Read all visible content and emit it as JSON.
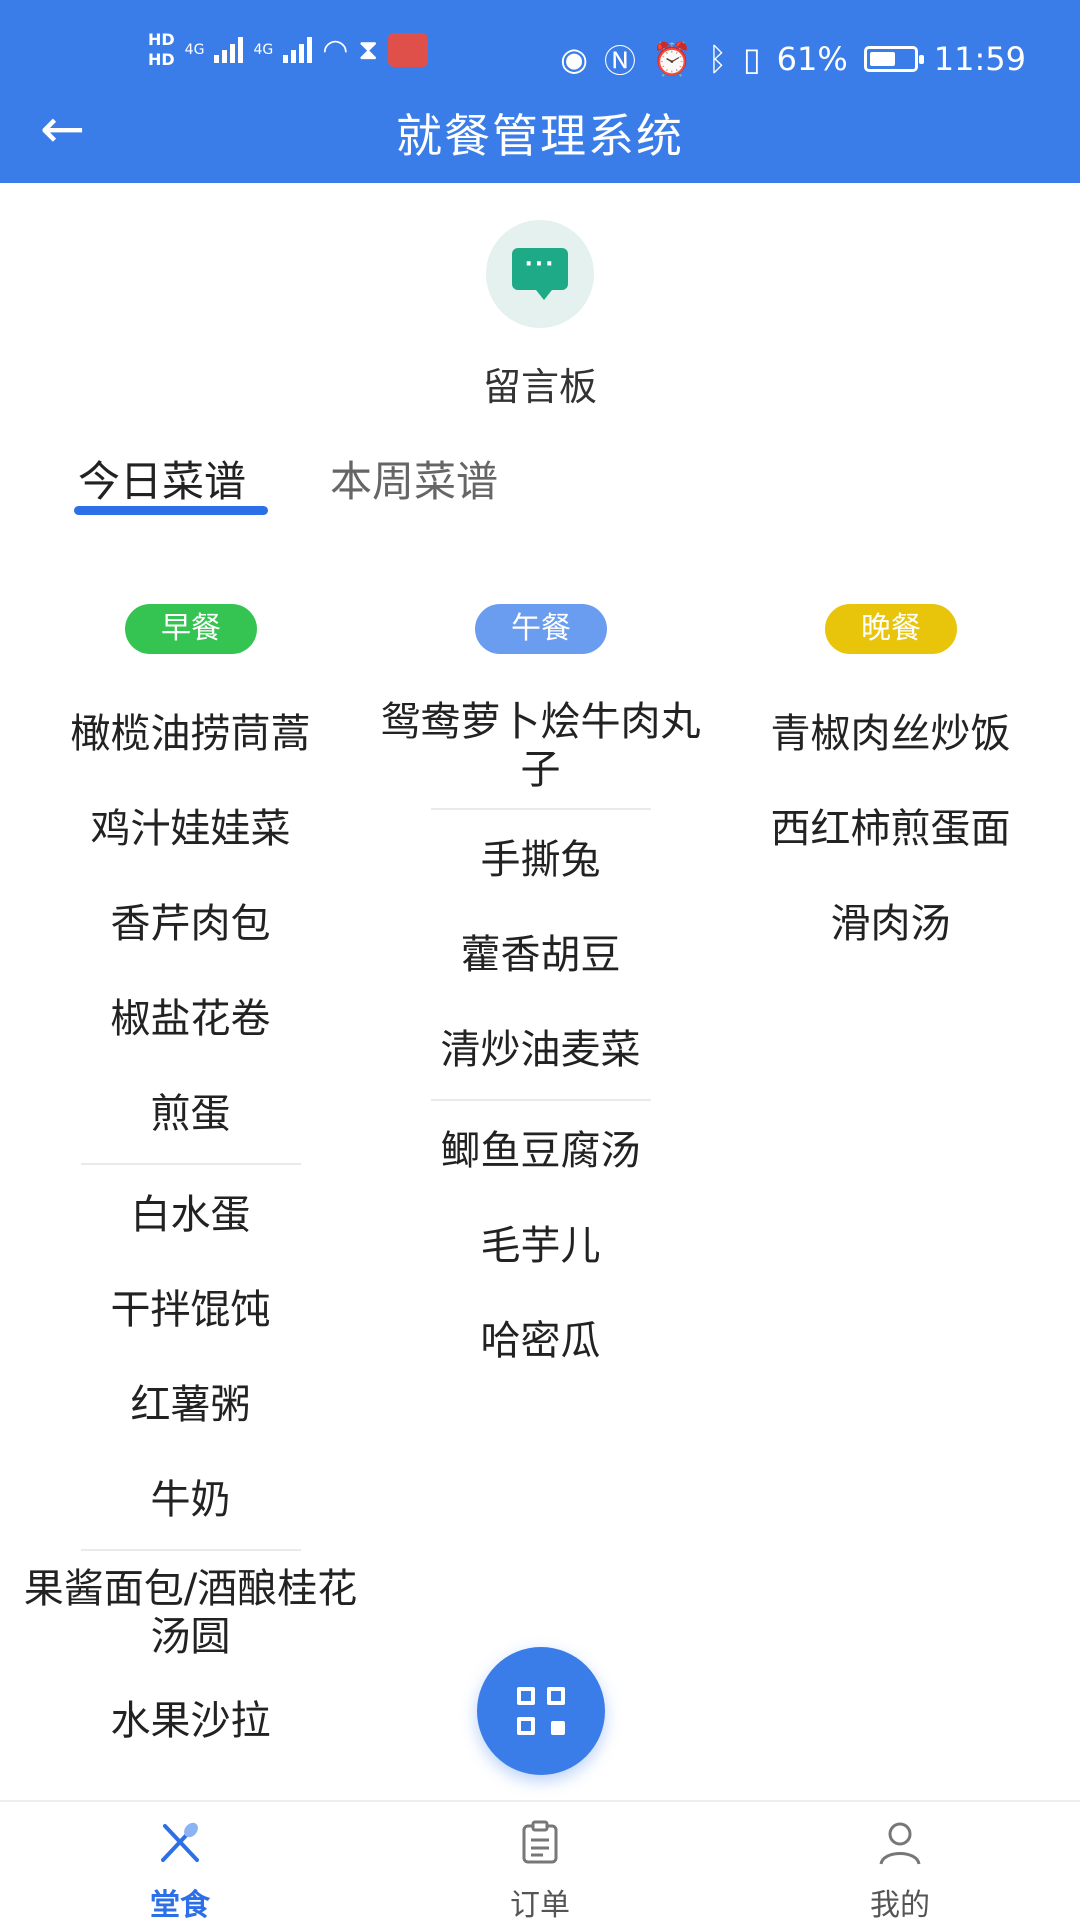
{
  "statusbar": {
    "hd1": "HD",
    "hd2": "HD",
    "net1": "4G",
    "net2": "4G",
    "battery_pct": "61%",
    "battery_level": 0.61,
    "time": "11:59"
  },
  "header": {
    "back_icon": "←",
    "title": "就餐管理系统"
  },
  "message_board": {
    "icon": "chat-bubble-icon",
    "icon_dots": "···",
    "label": "留言板"
  },
  "tabs": [
    {
      "label": "今日菜谱",
      "active": true
    },
    {
      "label": "本周菜谱",
      "active": false
    }
  ],
  "meals": [
    {
      "label": "早餐",
      "color": "#35c451",
      "dishes": [
        "橄榄油捞茼蒿",
        "鸡汁娃娃菜",
        "香芹肉包",
        "椒盐花卷",
        "煎蛋",
        "白水蛋",
        "干拌馄饨",
        "红薯粥",
        "牛奶",
        "果酱面包/酒酿桂花汤圆",
        "水果沙拉"
      ]
    },
    {
      "label": "午餐",
      "color": "#6a9cf0",
      "dishes": [
        "鸳鸯萝卜烩牛肉丸子",
        "手撕兔",
        "藿香胡豆",
        "清炒油麦菜",
        "鲫鱼豆腐汤",
        "毛芋儿",
        "哈密瓜"
      ]
    },
    {
      "label": "晚餐",
      "color": "#e8c40a",
      "dishes": [
        "青椒肉丝炒饭",
        "西红柿煎蛋面",
        "滑肉汤"
      ]
    }
  ],
  "fab": {
    "icon": "qr-code-icon"
  },
  "bottom_nav": [
    {
      "label": "堂食",
      "icon": "dining-icon",
      "active": true
    },
    {
      "label": "订单",
      "icon": "clipboard-icon",
      "active": false
    },
    {
      "label": "我的",
      "icon": "user-icon",
      "active": false
    }
  ],
  "colors": {
    "primary": "#3b7de8",
    "tab_indicator": "#2c6fe6",
    "message_icon": "#1eaa86"
  }
}
